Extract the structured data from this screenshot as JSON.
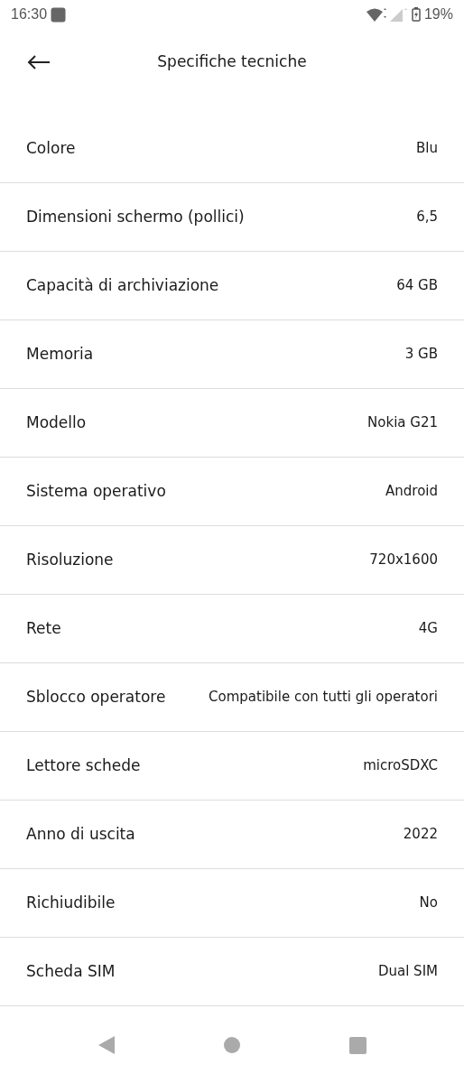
{
  "status_bar": {
    "time": "16:30",
    "battery": "19%"
  },
  "header": {
    "title": "Specifiche tecniche"
  },
  "specs": [
    {
      "label": "Colore",
      "value": "Blu"
    },
    {
      "label": "Dimensioni schermo (pollici)",
      "value": "6,5"
    },
    {
      "label": "Capacità di archiviazione",
      "value": "64 GB"
    },
    {
      "label": "Memoria",
      "value": "3 GB"
    },
    {
      "label": "Modello",
      "value": "Nokia G21"
    },
    {
      "label": "Sistema operativo",
      "value": "Android"
    },
    {
      "label": "Risoluzione",
      "value": "720x1600"
    },
    {
      "label": "Rete",
      "value": "4G"
    },
    {
      "label": "Sblocco operatore",
      "value": "Compatibile con tutti gli operatori"
    },
    {
      "label": "Lettore schede",
      "value": "microSDXC"
    },
    {
      "label": "Anno di uscita",
      "value": "2022"
    },
    {
      "label": "Richiudibile",
      "value": "No"
    },
    {
      "label": "Scheda SIM",
      "value": "Dual SIM"
    }
  ]
}
